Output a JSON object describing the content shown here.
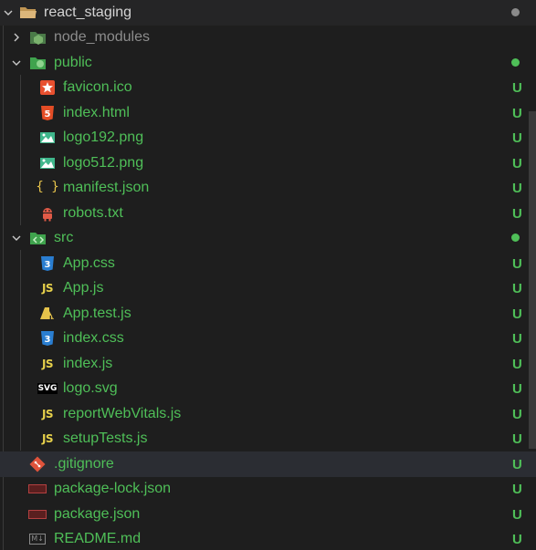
{
  "explorer": {
    "root": {
      "label": "react_staging"
    },
    "node_modules": {
      "label": "node_modules"
    },
    "public": {
      "label": "public",
      "files": [
        {
          "label": "favicon.ico",
          "status": "U"
        },
        {
          "label": "index.html",
          "status": "U"
        },
        {
          "label": "logo192.png",
          "status": "U"
        },
        {
          "label": "logo512.png",
          "status": "U"
        },
        {
          "label": "manifest.json",
          "status": "U"
        },
        {
          "label": "robots.txt",
          "status": "U"
        }
      ]
    },
    "src": {
      "label": "src",
      "files": [
        {
          "label": "App.css",
          "status": "U"
        },
        {
          "label": "App.js",
          "status": "U"
        },
        {
          "label": "App.test.js",
          "status": "U"
        },
        {
          "label": "index.css",
          "status": "U"
        },
        {
          "label": "index.js",
          "status": "U"
        },
        {
          "label": "logo.svg",
          "status": "U"
        },
        {
          "label": "reportWebVitals.js",
          "status": "U"
        },
        {
          "label": "setupTests.js",
          "status": "U"
        }
      ]
    },
    "rootFiles": [
      {
        "label": ".gitignore",
        "status": "U"
      },
      {
        "label": "package-lock.json",
        "status": "U"
      },
      {
        "label": "package.json",
        "status": "U"
      },
      {
        "label": "README.md",
        "status": "U"
      }
    ],
    "icons": {
      "js": "JS",
      "svg": "SVG",
      "md": "M↓",
      "brace": "{ }",
      "css": "3",
      "html": "5"
    },
    "colors": {
      "untracked": "#4fbf58",
      "folder_green": "#3fa34d",
      "text": "#c9c9c9"
    }
  }
}
